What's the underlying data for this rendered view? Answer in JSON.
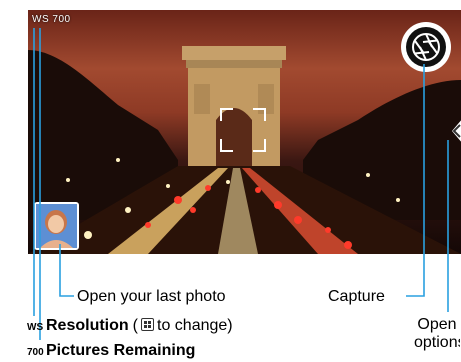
{
  "viewfinder": {
    "resolution_indicator": "WS 700",
    "colors": {
      "sky": "#a24a30",
      "hud_text": "#ffffff",
      "light_trails": "#ffd27a",
      "tail_lights": "#e0302a"
    }
  },
  "controls": {
    "capture_icon": "aperture-shutter-icon",
    "last_photo_icon": "photo-thumbnail-icon",
    "options_icon": "chevron-left-icon",
    "focus_icon": "focus-frame-icon"
  },
  "callouts": {
    "open_last_photo": "Open your last photo",
    "capture": "Capture",
    "open_options_line1": "Open",
    "open_options_line2": "options"
  },
  "legend": {
    "resolution": {
      "code": "WS",
      "label": "Resolution",
      "hint_open": "(",
      "hint_icon": "settings-grid-icon",
      "hint_close": " to change)"
    },
    "pictures_remaining": {
      "code": "700",
      "label": "Pictures Remaining"
    }
  }
}
